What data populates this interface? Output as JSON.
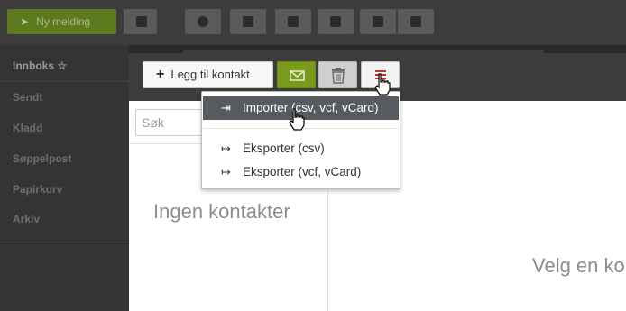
{
  "app": {
    "new_message": "Ny melding"
  },
  "sidebar": {
    "items": [
      {
        "label": "Innboks"
      },
      {
        "label": "Sendt"
      },
      {
        "label": "Kladd"
      },
      {
        "label": "Søppelpost"
      },
      {
        "label": "Papirkurv"
      },
      {
        "label": "Arkiv"
      }
    ]
  },
  "contacts": {
    "add_contact": "Legg til kontakt",
    "search_placeholder": "Søk",
    "empty_list": "Ingen kontakter",
    "select_prompt": "Velg en ko"
  },
  "menu": {
    "import": "Importer (csv, vcf, vCard)",
    "export_csv": "Eksporter (csv)",
    "export_vcf": "Eksporter (vcf, vCard)"
  },
  "colors": {
    "accent_green": "#7a9a1c",
    "menu_red": "#c0392b",
    "highlight": "#565b61"
  }
}
